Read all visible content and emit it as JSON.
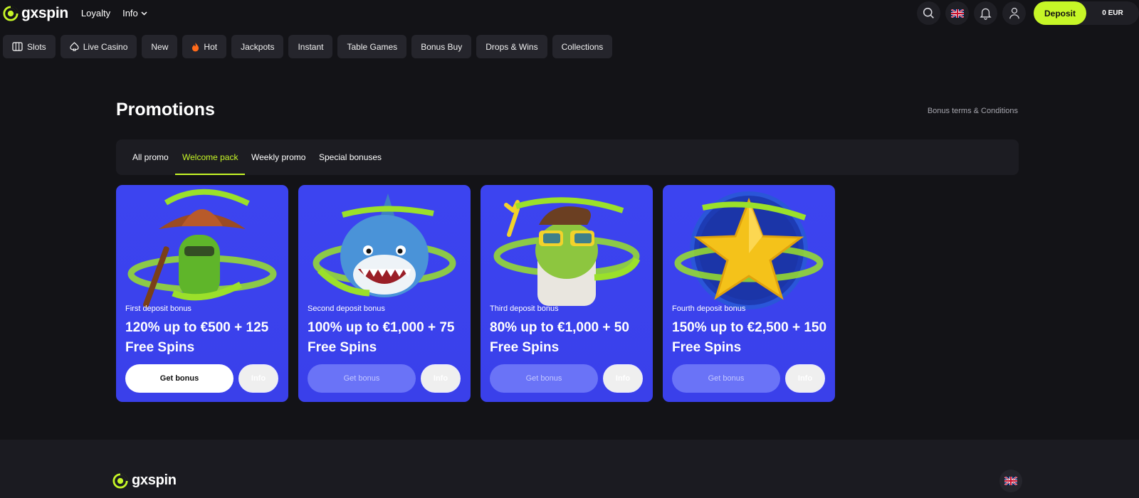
{
  "brand": {
    "name": "gxspin",
    "accent": "#c6f627"
  },
  "nav": {
    "links": [
      {
        "label": "Loyalty"
      },
      {
        "label": "Info"
      }
    ]
  },
  "header": {
    "deposit_label": "Deposit",
    "balance": "0 EUR",
    "icons": [
      "search-icon",
      "uk-flag-icon",
      "bell-icon",
      "user-icon"
    ]
  },
  "categories": [
    {
      "label": "Slots",
      "icon": "slots-icon"
    },
    {
      "label": "Live Casino",
      "icon": "spade-icon"
    },
    {
      "label": "New"
    },
    {
      "label": "Hot",
      "icon": "flame-icon"
    },
    {
      "label": "Jackpots"
    },
    {
      "label": "Instant"
    },
    {
      "label": "Table Games"
    },
    {
      "label": "Bonus Buy"
    },
    {
      "label": "Drops & Wins"
    },
    {
      "label": "Collections"
    }
  ],
  "promotions": {
    "title": "Promotions",
    "terms_link": "Bonus terms & Conditions",
    "tabs": [
      {
        "label": "All promo",
        "active": false
      },
      {
        "label": "Welcome pack",
        "active": true
      },
      {
        "label": "Weekly promo",
        "active": false
      },
      {
        "label": "Special bonuses",
        "active": false
      }
    ],
    "cards": [
      {
        "subtitle": "First deposit bonus",
        "title": "120% up to €500 + 125 Free Spins",
        "get_label": "Get bonus",
        "info_label": "Info",
        "art": "cactus-cowboy"
      },
      {
        "subtitle": "Second deposit bonus",
        "title": "100% up to €1,000 + 75 Free Spins",
        "get_label": "Get bonus",
        "info_label": "Info",
        "art": "shark"
      },
      {
        "subtitle": "Third deposit bonus",
        "title": "80% up to €1,000 + 50 Free Spins",
        "get_label": "Get bonus",
        "info_label": "Info",
        "art": "frog"
      },
      {
        "subtitle": "Fourth deposit bonus",
        "title": "150% up to €2,500 + 150 Free Spins",
        "get_label": "Get bonus",
        "info_label": "Info",
        "art": "star"
      }
    ]
  },
  "footer": {
    "brand": "gxspin"
  }
}
